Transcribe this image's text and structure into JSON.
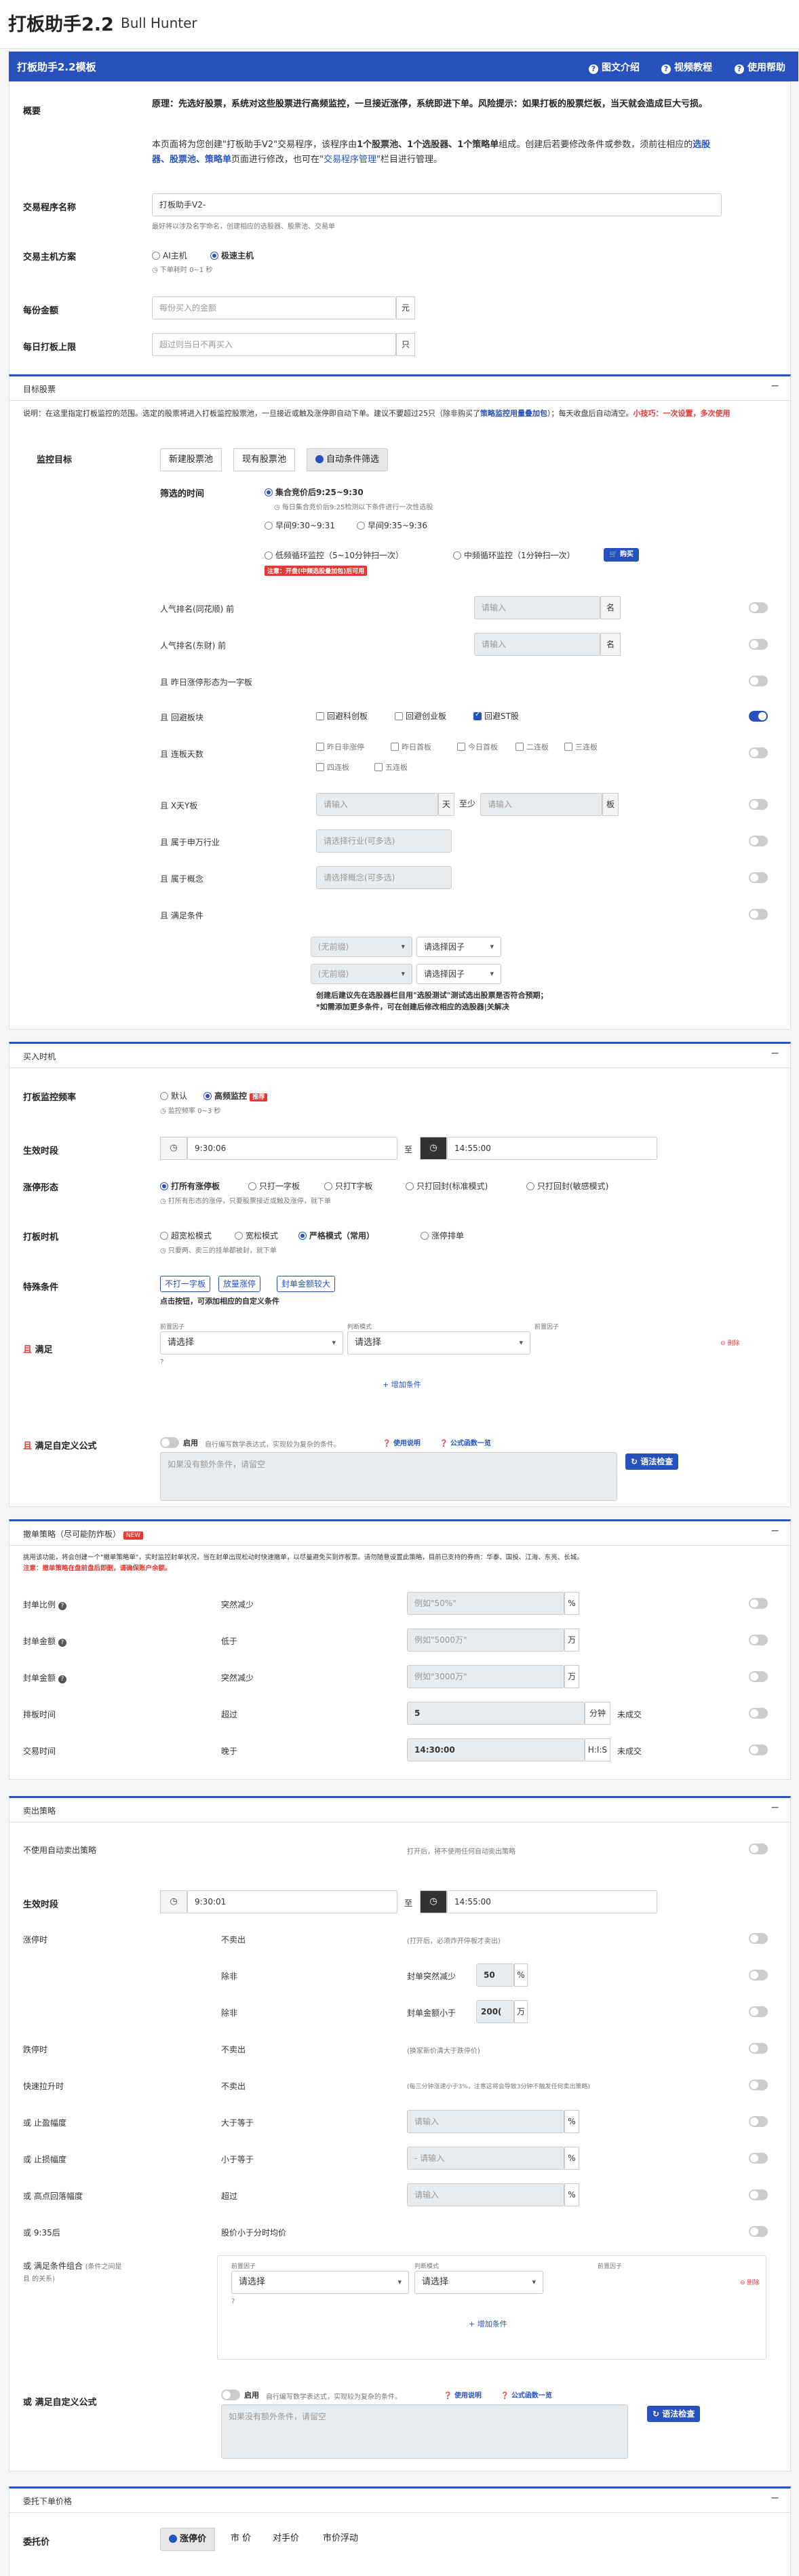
{
  "app": {
    "title": "打板助手2.2",
    "subtitle": "Bull Hunter",
    "nav_title": "打板助手2.2模板",
    "links": [
      "图文介绍",
      "视频教程",
      "使用帮助"
    ]
  },
  "overview": {
    "label": "概要",
    "p1": "原理：先选好股票，系统对这些股票进行高频监控，一旦接近涨停，系统即进下单。风险提示：如果打板的股票烂板，当天就会造成巨大亏损。",
    "p2a": "本页面将为您创建\"打板助手V2\"交易程序，该程序由",
    "p2b": "1个股票池、1个选股器、1个策略单",
    "p2c": "组成。创建后若要修改条件或参数，须前往相应的",
    "p2d": "选股器、股票池、策略单",
    "p2e": "页面进行修改，也可在\"",
    "p2f": "交易程序管理",
    "p2g": "\"栏目进行管理。"
  },
  "program": {
    "name_label": "交易程序名称",
    "name_value": "打板助手V2-",
    "name_hint": "最好将以涉及名字命名，创建相应的选股器、股票池、交易单",
    "host_label": "交易主机方案",
    "host_opts": [
      "AI主机",
      "极速主机"
    ],
    "host_hint": "下单耗时 0~1 秒",
    "amount_label": "每份金额",
    "amount_ph": "每份买入的金额",
    "amount_unit": "元",
    "limit_label": "每日打板上限",
    "limit_ph": "超过则当日不再买入",
    "limit_unit": "只"
  },
  "target": {
    "head": "目标股票",
    "desc": "说明：在这里指定打板监控的范围。选定的股票将进入打板监控股票池，一旦接近或触及涨停即自动下单。建议不要超过25只（除非购买了",
    "desc_link": "策略监控用量叠加包",
    "desc2": "）；每天收盘后自动清空。",
    "tip_red": "小技巧：一次设置，多次使用",
    "monitor_label": "监控目标",
    "tabs": [
      "新建股票池",
      "现有股票池",
      "自动条件筛选"
    ],
    "filter_time_label": "筛选的时间",
    "t_opt1": "集合竞价后9:25~9:30",
    "t_opt1_hint": "每日集合竞价后9:25检测以下条件进行一次性选股",
    "t_opt2": "早间9:30~9:31",
    "t_opt3": "早间9:35~9:36",
    "t_opt4": "低频循环监控（5~10分钟扫一次）",
    "t_opt5": "中频循环监控（1分钟扫一次）",
    "t_buy": "购买",
    "t_note": "注意：开盘(中频选股叠加包)后可用",
    "rows": [
      {
        "label": "人气排名(同花顺) 前",
        "ph": "请输入",
        "unit": "名"
      },
      {
        "label": "人气排名(东财) 前",
        "ph": "请输入",
        "unit": "名"
      },
      {
        "label": "且 昨日涨停形态为一字板"
      },
      {
        "label": "且 回避板块",
        "opts": [
          "回避科创板",
          "回避创业板",
          "回避ST股"
        ]
      },
      {
        "label": "且 连板天数",
        "opts": [
          "昨日非涨停",
          "昨日首板",
          "今日首板",
          "二连板",
          "三连板",
          "四连板",
          "五连板"
        ]
      },
      {
        "label": "且 X天Y板",
        "ph1": "请输入",
        "u1": "天",
        "mid": "至少",
        "ph2": "请输入",
        "u2": "板"
      },
      {
        "label": "且 属于申万行业",
        "ph": "请选择行业(可多选)"
      },
      {
        "label": "且 属于概念",
        "ph": "请选择概念(可多选)"
      },
      {
        "label": "且 满足条件"
      }
    ],
    "cond_sel1": "(无前缀)",
    "cond_sel2": "请选择因子",
    "cond_note1": "创建后建议先在选股器栏目用\"选股测试\"测试选出股票是否符合预期；",
    "cond_note2": "*如需添加更多条件，可在创建后修改相应的选股器|关解决"
  },
  "buy": {
    "head": "买入时机",
    "freq_label": "打板监控频率",
    "freq_opts": [
      "默认",
      "高频监控"
    ],
    "freq_badge": "推荐",
    "freq_hint": "监控频率 0~3 秒",
    "time_label": "生效时段",
    "time_start": "9:30:06",
    "time_to": "至",
    "time_end": "14:55:00",
    "shape_label": "涨停形态",
    "shape_opts": [
      "打所有涨停板",
      "只打一字板",
      "只打T字板",
      "只打回封(标准模式)",
      "只打回封(敏感模式)"
    ],
    "shape_hint": "打所有形态的涨停，只要股票接近或触及涨停，就下单",
    "timing_label": "打板时机",
    "timing_opts": [
      "超宽松模式",
      "宽松模式",
      "严格模式（常用）",
      "涨停排单"
    ],
    "timing_hint": "只要两、卖三的挂单都被封，就下单",
    "special_label": "特殊条件",
    "special_btns": [
      "不打一字板",
      "放量涨停",
      "封单金额较大"
    ],
    "special_hint": "点击按钮，可添加相应的自定义条件",
    "satisfy_label": "满足",
    "satisfy_prefix": "且",
    "col1": "前置因子",
    "col2": "判断模式",
    "col3": "前置因子",
    "sel": "请选择",
    "del": "删除",
    "add": "增加条件",
    "formula_label": "满足自定义公式",
    "enable": "启用",
    "formula_hint": "自行编写数学表达式，实现较为复杂的条件。",
    "help": "使用说明",
    "fx": "公式函数一览",
    "formula_ph": "如果没有额外条件，请留空",
    "check": "语法检查"
  },
  "cancel": {
    "head": "撤单策略（尽可能防炸板）",
    "badge": "NEW",
    "desc": "挑用该功能，将会创建一个\"撤单策略单\"，实时监控封单状况，当在封单出现松动时快速撤单，以尽量避免买到炸板票。请勿随意设置此策略，目前已支持的券商：华泰、国投、江海、东亮、长城。",
    "desc_red": "注意：撤单策略在盘前盘后即删，请确保账户余额。",
    "rows": [
      {
        "label": "封单比例",
        "cond": "突然减少",
        "ph": "例如\"50%\"",
        "unit": "%"
      },
      {
        "label": "封单金额",
        "cond": "低于",
        "ph": "例如\"5000万\"",
        "unit": "万"
      },
      {
        "label": "封单金额",
        "cond": "突然减少",
        "ph": "例如\"3000万\"",
        "unit": "万"
      },
      {
        "label": "排板时间",
        "cond": "超过",
        "val": "5",
        "unit": "分钟",
        "extra": "未成交"
      },
      {
        "label": "交易时间",
        "cond": "晚于",
        "val": "14:30:00",
        "unit": "H:I:S",
        "extra": "未成交"
      }
    ]
  },
  "sell": {
    "head": "卖出策略",
    "no_auto": "不使用自动卖出策略",
    "no_auto_hint": "打开后，将不使用任何自动卖出策略",
    "time_label": "生效时段",
    "time_start": "9:30:01",
    "time_to": "至",
    "time_end": "14:55:00",
    "zt_label": "涨停时",
    "zt_a": "不卖出",
    "zt_a_hint": "(打开后，必须炸开停板才卖出)",
    "zt_b": "除非",
    "zt_b_txt": "封单突然减少",
    "zt_b_val": "50",
    "zt_b_unit": "%",
    "zt_c": "除非",
    "zt_c_txt": "封单金额小于",
    "zt_c_val": "200(",
    "zt_c_unit": "万",
    "dt_label": "跌停时",
    "dt_a": "不卖出",
    "dt_hint": "(换家新价清大于跌停价)",
    "fast_label": "快速拉升时",
    "fast_a": "不卖出",
    "fast_hint": "(每三分钟涨速小于3%，注意这将会导致3分钟不触发任何卖出策略)",
    "rows": [
      {
        "label": "或 止盈幅度",
        "cond": "大于等于",
        "ph": "请输入",
        "unit": "%"
      },
      {
        "label": "或 止损幅度",
        "cond": "小于等于",
        "ph": "- 请输入",
        "unit": "%"
      },
      {
        "label": "或 高点回落幅度",
        "cond": "超过",
        "ph": "请输入",
        "unit": "%"
      }
    ],
    "r935_label": "或 9:35后",
    "r935_txt": "股价小于分时均价",
    "combo_label": "或 满足条件组合",
    "combo_hint": "(条件之间是 且 的关系)",
    "col1": "前置因子",
    "col2": "判断模式",
    "col3": "前置因子",
    "sel": "请选择",
    "del": "删除",
    "add": "增加条件",
    "formula_label": "或 满足自定义公式",
    "enable": "启用",
    "formula_hint": "自行编写数学表达式，实现较为复杂的条件。",
    "help": "使用说明",
    "fx": "公式函数一览",
    "formula_ph": "如果没有额外条件，请留空",
    "check": "语法检查"
  },
  "order": {
    "head": "委托下单价格",
    "label": "委托价",
    "tabs": [
      "涨停价",
      "市 价",
      "对手价",
      "市价浮动"
    ]
  }
}
